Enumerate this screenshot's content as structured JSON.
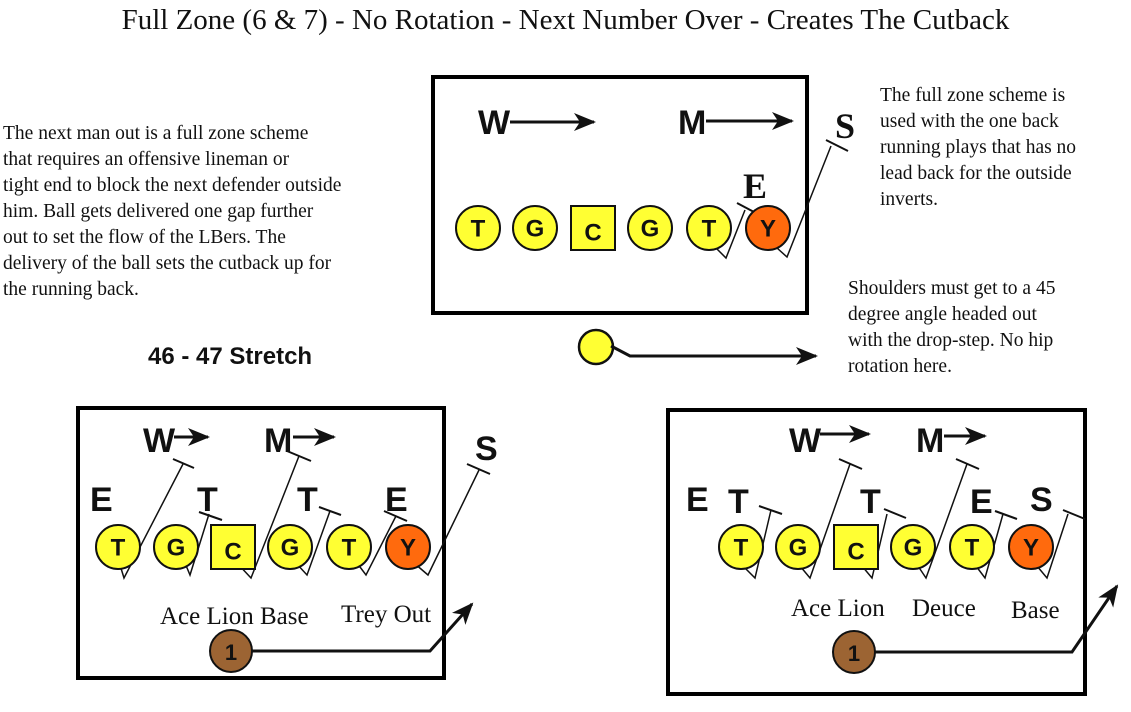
{
  "title": "Full Zone (6 & 7) - No Rotation - Next Number Over - Creates The Cutback",
  "notes": {
    "left": "The next man out is a full zone scheme\nthat requires an offensive lineman or\ntight end to block the next defender outside\nhim.  Ball gets delivered one gap further\nout to set the flow of the LBers.  The\ndelivery of the ball sets the cutback up for\nthe running back.",
    "right_top": "The full zone scheme is\nused with the one back\nrunning plays that has no\nlead back for the outside\ninverts.",
    "right_mid": "Shoulders must get to a 45\ndegree angle headed out\nwith the drop-step.  No hip\nrotation here."
  },
  "subtitle": "46 - 47 Stretch",
  "colors": {
    "lineman": "#ffff33",
    "tight_end": "#ff6a0d",
    "back": "#9c6433",
    "border": "#000000"
  },
  "diagrams": [
    {
      "id": "top",
      "linebackers": [
        "W",
        "M"
      ],
      "defense": [
        "E",
        "S"
      ],
      "offense": [
        "T",
        "G",
        "C",
        "G",
        "T",
        "Y"
      ],
      "formation_labels": [],
      "back_label": ""
    },
    {
      "id": "bottom-left",
      "linebackers": [
        "W",
        "M"
      ],
      "defense": [
        "E",
        "T",
        "T",
        "E",
        "S"
      ],
      "offense": [
        "T",
        "G",
        "C",
        "G",
        "T",
        "Y"
      ],
      "formation_labels": [
        "Ace Lion Base",
        "Trey Out"
      ],
      "back_label": "1"
    },
    {
      "id": "bottom-right",
      "linebackers": [
        "W",
        "M"
      ],
      "defense": [
        "E",
        "T",
        "T",
        "E",
        "S"
      ],
      "offense": [
        "T",
        "G",
        "C",
        "G",
        "T",
        "Y"
      ],
      "formation_labels": [
        "Ace Lion",
        "Deuce",
        "Base"
      ],
      "back_label": "1"
    }
  ]
}
